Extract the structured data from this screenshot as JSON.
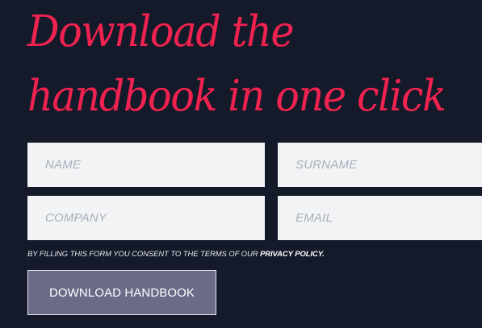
{
  "headline": {
    "line1": "Download the",
    "line2": "handbook in one click"
  },
  "form": {
    "name_placeholder": "NAME",
    "surname_placeholder": "SURNAME",
    "company_placeholder": "COMPANY",
    "email_placeholder": "EMAIL",
    "name_value": "",
    "surname_value": "",
    "company_value": "",
    "email_value": ""
  },
  "consent": {
    "text": "BY FILLING THIS FORM YOU CONSENT TO THE TERMS OF OUR ",
    "link_label": "PRIVACY POLICY."
  },
  "download_button_label": "DOWNLOAD HANDBOOK",
  "colors": {
    "background": "#141a2a",
    "headline": "#f0224f",
    "field_background": "#f2f3f5",
    "button_background": "#6a6b87"
  }
}
